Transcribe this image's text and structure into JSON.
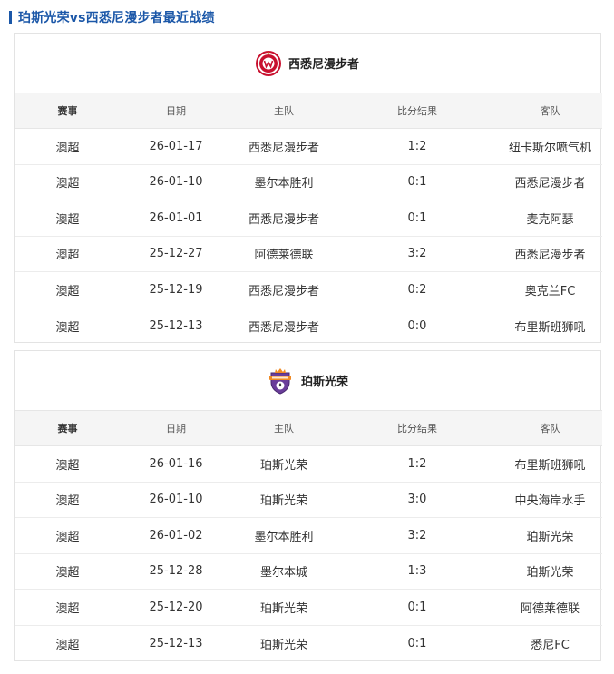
{
  "page": {
    "title": "珀斯光荣vs西悉尼漫步者最近战绩"
  },
  "columns": [
    "赛事",
    "日期",
    "主队",
    "比分结果",
    "客队"
  ],
  "sections": [
    {
      "team": "西悉尼漫步者",
      "logo_icon": "western-sydney-wanderers-logo-icon",
      "rows": [
        [
          "澳超",
          "26-01-17",
          "西悉尼漫步者",
          "1:2",
          "纽卡斯尔喷气机"
        ],
        [
          "澳超",
          "26-01-10",
          "墨尔本胜利",
          "0:1",
          "西悉尼漫步者"
        ],
        [
          "澳超",
          "26-01-01",
          "西悉尼漫步者",
          "0:1",
          "麦克阿瑟"
        ],
        [
          "澳超",
          "25-12-27",
          "阿德莱德联",
          "3:2",
          "西悉尼漫步者"
        ],
        [
          "澳超",
          "25-12-19",
          "西悉尼漫步者",
          "0:2",
          "奥克兰FC"
        ],
        [
          "澳超",
          "25-12-13",
          "西悉尼漫步者",
          "0:0",
          "布里斯班狮吼"
        ]
      ]
    },
    {
      "team": "珀斯光荣",
      "logo_icon": "perth-glory-logo-icon",
      "rows": [
        [
          "澳超",
          "26-01-16",
          "珀斯光荣",
          "1:2",
          "布里斯班狮吼"
        ],
        [
          "澳超",
          "26-01-10",
          "珀斯光荣",
          "3:0",
          "中央海岸水手"
        ],
        [
          "澳超",
          "26-01-02",
          "墨尔本胜利",
          "3:2",
          "珀斯光荣"
        ],
        [
          "澳超",
          "25-12-28",
          "墨尔本城",
          "1:3",
          "珀斯光荣"
        ],
        [
          "澳超",
          "25-12-20",
          "珀斯光荣",
          "0:1",
          "阿德莱德联"
        ],
        [
          "澳超",
          "25-12-13",
          "珀斯光荣",
          "0:1",
          "悉尼FC"
        ]
      ]
    }
  ],
  "colors": {
    "accent": "#1b57a8",
    "header_bg": "#f5f5f5",
    "wsw_red": "#c8102e",
    "perth_purple": "#6a3d9a",
    "perth_orange": "#f08a24"
  }
}
